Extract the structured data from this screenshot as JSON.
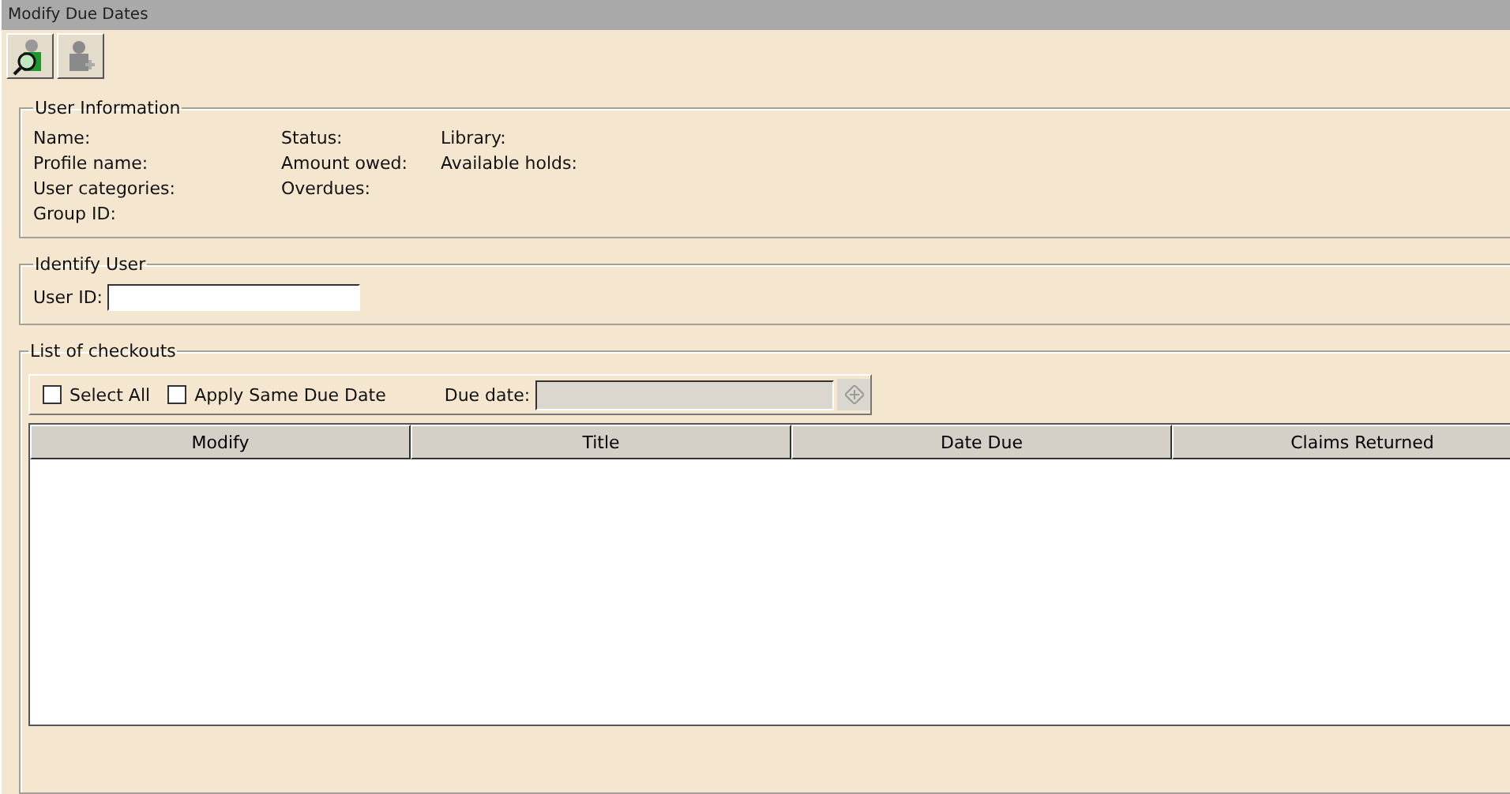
{
  "window": {
    "title": "Modify Due Dates"
  },
  "toolbar": [
    {
      "kind": "search-user",
      "disabled": false
    },
    {
      "kind": "add-user",
      "disabled": true
    }
  ],
  "user_information": {
    "legend": "User Information",
    "columns": [
      [
        "Name:",
        "Profile name:",
        "User categories:",
        "Group ID:"
      ],
      [
        "Status:",
        "Amount owed:",
        "Overdues:"
      ],
      [
        "Library:",
        "Available holds:"
      ]
    ]
  },
  "identify_user": {
    "legend": "Identify User",
    "user_id_label": "User ID:"
  },
  "checkouts": {
    "legend": "List of checkouts",
    "options": [
      {
        "label": "Select All",
        "checked": false
      },
      {
        "label": "Apply Same Due Date",
        "checked": false
      }
    ],
    "due_date_label": "Due date:",
    "due_date_disabled": true,
    "columns": [
      "Modify",
      "Title",
      "Date Due",
      "Claims Returned"
    ]
  }
}
